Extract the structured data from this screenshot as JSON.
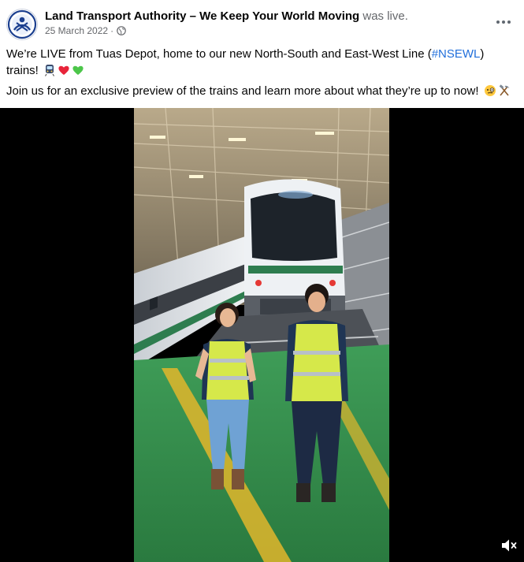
{
  "post": {
    "page_name": "Land Transport Authority – We Keep Your World Moving",
    "status": "was live.",
    "date": "25 March 2022",
    "separator": "·",
    "audience_icon": "globe-icon",
    "more_icon": "more-options-icon"
  },
  "body": {
    "line1_start": "We’re LIVE from Tuas Depot, home to our new North-South and East-West Line (",
    "hashtag": "#NSEWL",
    "line1_end": ")",
    "line1_cont": "trains! ",
    "emojis1": [
      "train-emoji",
      "red-heart-emoji",
      "green-heart-emoji"
    ],
    "line2": "Join us for an exclusive preview of the trains and learn more about what they’re up to now! ",
    "emojis2": [
      "monocle-face-emoji",
      "hammer-and-pick-emoji"
    ]
  },
  "video": {
    "mute_icon": "volume-muted-icon"
  },
  "colors": {
    "hashtag": "#216fdb",
    "meta_text": "#65676b",
    "train_body": "#dfe3e8",
    "train_stripe": "#2e7d4f",
    "floor": "#2f8a48",
    "vest": "#d6e84a"
  }
}
